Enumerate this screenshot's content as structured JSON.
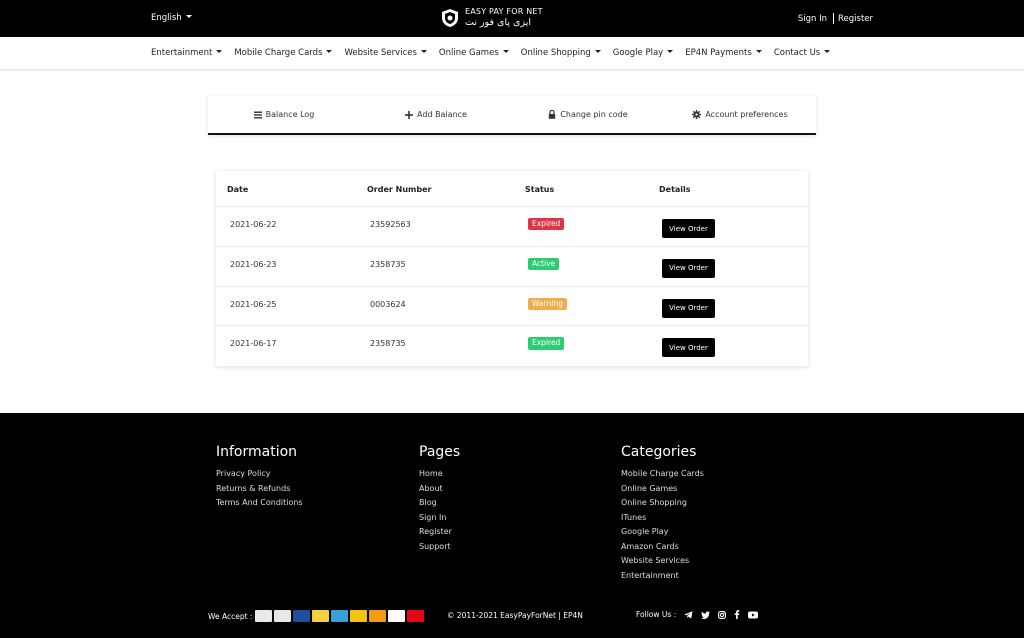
{
  "topbar": {
    "language": "English",
    "logo_en": "EASY PAY FOR NET",
    "logo_ar": "ایزی پای فور نت",
    "sign_in": "Sign In",
    "register": "Register"
  },
  "nav": {
    "items": [
      "Entertainment",
      "Mobile Charge Cards",
      "Website Services",
      "Online Games",
      "Online Shopping",
      "Google Play",
      "EP4N Payments",
      "Contact Us"
    ]
  },
  "tabs": [
    {
      "label": "Balance Log",
      "icon": "list-icon"
    },
    {
      "label": "Add Balance",
      "icon": "plus-icon"
    },
    {
      "label": "Change pin code",
      "icon": "lock-icon"
    },
    {
      "label": "Account preferences",
      "icon": "gear-icon"
    }
  ],
  "orders": {
    "headers": [
      "Date",
      "Order Number",
      "Status",
      "Details"
    ],
    "button_label": "View Order",
    "rows": [
      {
        "date": "2021-06-22",
        "order": "23592563",
        "status": "Expired",
        "color": "#dc3545"
      },
      {
        "date": "2021-06-23",
        "order": "2358735",
        "status": "Active",
        "color": "#2ecc71"
      },
      {
        "date": "2021-06-25",
        "order": "0003624",
        "status": "Warning",
        "color": "#f0ad4e"
      },
      {
        "date": "2021-06-17",
        "order": "2358735",
        "status": "Expired",
        "color": "#2ecc71"
      }
    ]
  },
  "footer": {
    "information": {
      "title": "Information",
      "links": [
        "Privacy Policy",
        "Returns & Refunds",
        "Terms And Conditions"
      ]
    },
    "pages": {
      "title": "Pages",
      "links": [
        "Home",
        "About",
        "Blog",
        "Sign In",
        "Register",
        "Support"
      ]
    },
    "categories": {
      "title": "Categories",
      "links": [
        "Mobile Charge Cards",
        "Online Games",
        "Online Shopping",
        "ITunes",
        "Google Play",
        "Amazon Cards",
        "Website Services",
        "Entertainment"
      ]
    },
    "we_accept": "We Accept :",
    "copyright": "© 2011-2021 EasyPayForNet | EP4N",
    "follow_us": "Follow Us :",
    "social_icons": [
      "telegram-icon",
      "twitter-icon",
      "instagram-icon",
      "facebook-icon",
      "youtube-icon"
    ],
    "payment_colors": [
      "#e8e8e8",
      "#e8e8e8",
      "#1f4e9c",
      "#f4d03f",
      "#3aa0d8",
      "#f1c40f",
      "#f39c12",
      "#ffffff",
      "#e30613"
    ]
  }
}
